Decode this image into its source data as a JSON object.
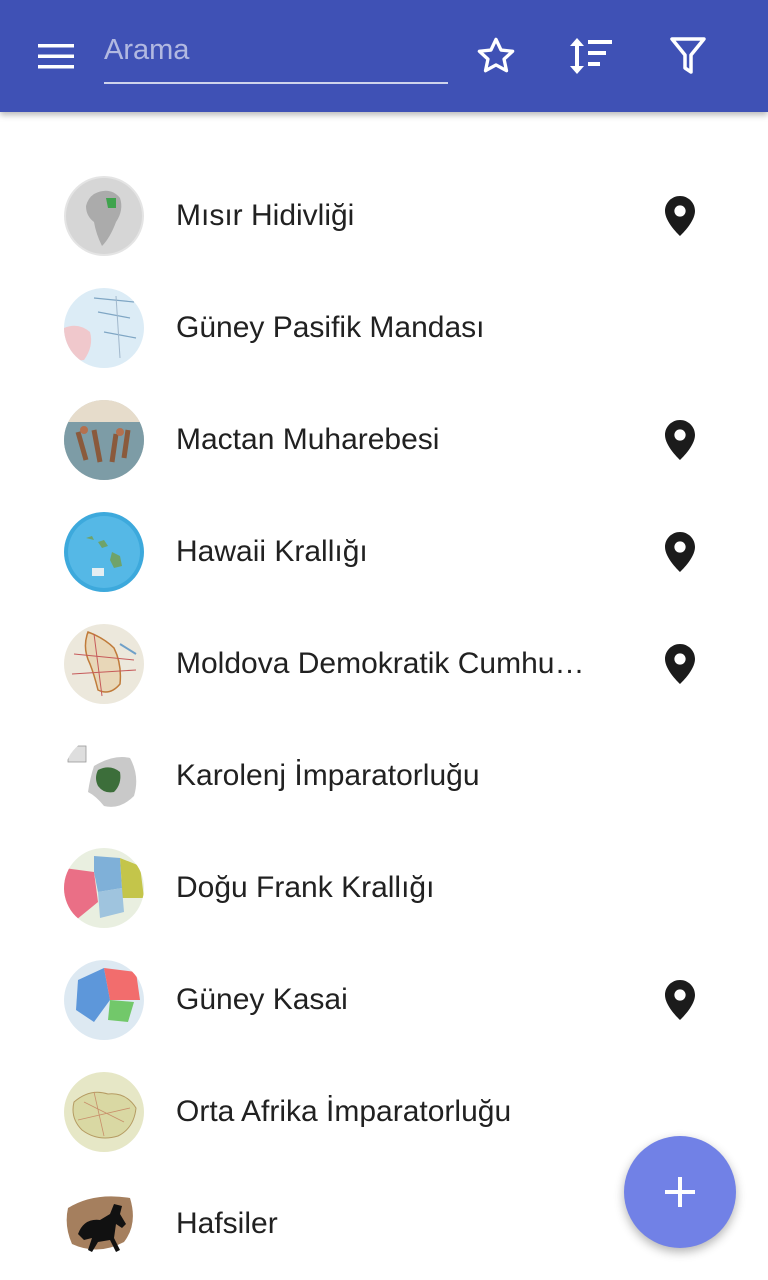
{
  "appbar": {
    "color": "#3f51b5",
    "menu_icon": "menu-icon",
    "search": {
      "placeholder": "Arama",
      "value": ""
    },
    "actions": [
      "star-outline-icon",
      "sort-icon",
      "filter-icon"
    ]
  },
  "items": [
    {
      "label": "Mısır Hidivliği",
      "has_location": true
    },
    {
      "label": "Güney Pasifik Mandası",
      "has_location": false
    },
    {
      "label": "Mactan Muharebesi",
      "has_location": true
    },
    {
      "label": "Hawaii Krallığı",
      "has_location": true
    },
    {
      "label": "Moldova Demokratik Cumhuriyeti",
      "has_location": true
    },
    {
      "label": "Karolenj İmparatorluğu",
      "has_location": false
    },
    {
      "label": "Doğu Frank Krallığı",
      "has_location": false
    },
    {
      "label": "Güney Kasai",
      "has_location": true
    },
    {
      "label": "Orta Afrika İmparatorluğu",
      "has_location": false
    },
    {
      "label": "Hafsiler",
      "has_location": false
    }
  ],
  "fab": {
    "icon": "plus-icon",
    "color": "#7181e6"
  }
}
